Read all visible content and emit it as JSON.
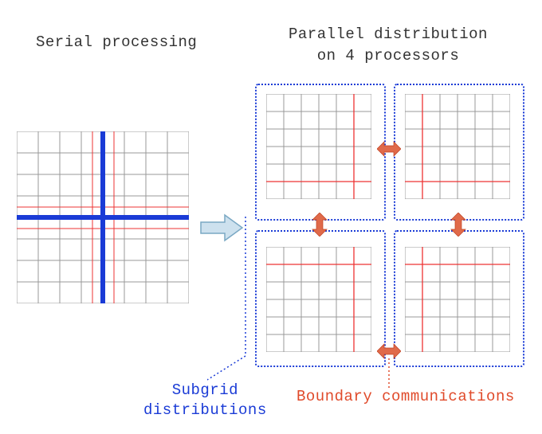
{
  "titles": {
    "serial": "Serial processing",
    "parallel_l1": "Parallel distribution",
    "parallel_l2": "on 4 processors"
  },
  "labels": {
    "subgrid_l1": "Subgrid",
    "subgrid_l2": "distributions",
    "boundary": "Boundary communications"
  },
  "colors": {
    "blue": "#1a3bd6",
    "orange": "#e04a2a",
    "red": "#e33",
    "gridline": "#888",
    "arrowfill": "#c9dbe9",
    "arrowstroke": "#5a8bb0"
  },
  "layout": {
    "serial_cells": 8,
    "sub_cells": 6
  }
}
